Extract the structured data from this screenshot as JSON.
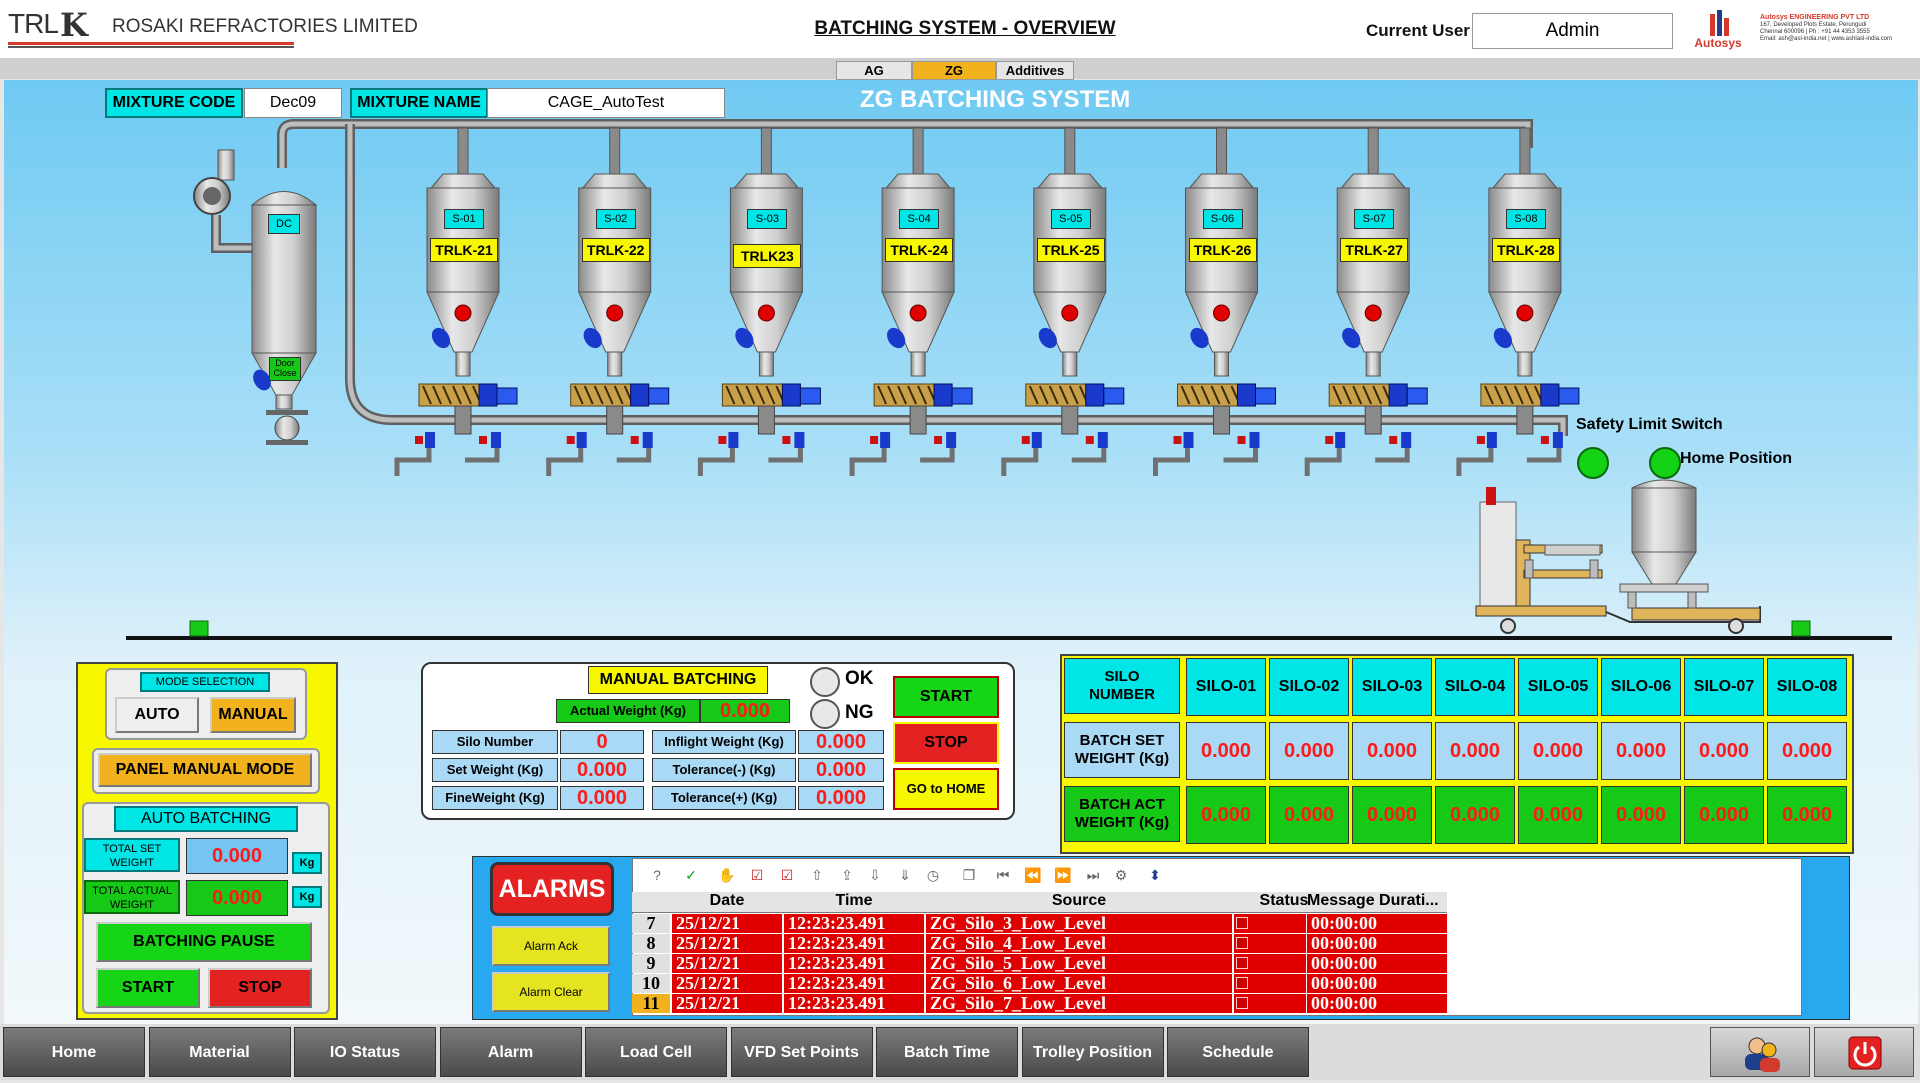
{
  "header": {
    "company_logo_text": "TRL",
    "company_k": "K",
    "company_name": "ROSAKI REFRACTORIES LIMITED",
    "screen_title": "BATCHING SYSTEM - OVERVIEW",
    "current_user_label": "Current User",
    "current_user_value": "Admin",
    "vendor_name": "Autosys",
    "vendor_company": "Autosys ENGINEERING PVT LTD",
    "vendor_address_1": "167, Developed Plots Estate, Perungudi",
    "vendor_address_2": "Chennai 600096 | Ph : +91 44 4353 3555",
    "vendor_address_3": "Email: ash@asl-india.net | www.ashlasl-india.com"
  },
  "tabs": [
    {
      "label": "AG"
    },
    {
      "label": "ZG",
      "active": true
    },
    {
      "label": "Additives"
    }
  ],
  "mixture": {
    "code_label": "MIXTURE CODE",
    "code_value": "Dec09",
    "name_label": "MIXTURE NAME",
    "name_value": "CAGE_AutoTest"
  },
  "system_title": "ZG BATCHING SYSTEM",
  "dust_collector": {
    "label": "DC",
    "door_label_1": "Door",
    "door_label_2": "Close"
  },
  "silos": [
    {
      "id": "S-01",
      "name": "TRLK-21"
    },
    {
      "id": "S-02",
      "name": "TRLK-22"
    },
    {
      "id": "S-03",
      "name": "TRLK23"
    },
    {
      "id": "S-04",
      "name": "TRLK-24"
    },
    {
      "id": "S-05",
      "name": "TRLK-25"
    },
    {
      "id": "S-06",
      "name": "TRLK-26"
    },
    {
      "id": "S-07",
      "name": "TRLK-27"
    },
    {
      "id": "S-08",
      "name": "TRLK-28"
    }
  ],
  "indicators": {
    "safety_limit_switch": "Safety Limit Switch",
    "home_position": "Home Position",
    "on_color": "#14d214",
    "alarm_color": "#e00000"
  },
  "mode_panel": {
    "mode_selection_label": "MODE SELECTION",
    "auto_label": "AUTO",
    "manual_label": "MANUAL",
    "panel_manual_mode_label": "PANEL MANUAL MODE",
    "auto_batching_label": "AUTO BATCHING",
    "total_set_weight_label_1": "TOTAL  SET",
    "total_set_weight_label_2": "WEIGHT",
    "total_set_weight_value": "0.000",
    "total_actual_weight_label_1": "TOTAL  ACTUAL",
    "total_actual_weight_label_2": "WEIGHT",
    "total_actual_weight_value": "0.000",
    "unit": "Kg",
    "batching_pause_label": "BATCHING PAUSE",
    "start_label": "START",
    "stop_label": "STOP"
  },
  "manual_batching": {
    "title": "MANUAL BATCHING",
    "actual_weight_label": "Actual Weight (Kg)",
    "actual_weight_value": "0.000",
    "ok_label": "OK",
    "ng_label": "NG",
    "silo_number_label": "Silo Number",
    "silo_number_value": "0",
    "set_weight_label": "Set Weight (Kg)",
    "set_weight_value": "0.000",
    "fine_weight_label": "FineWeight (Kg)",
    "fine_weight_value": "0.000",
    "inflight_weight_label": "Inflight Weight (Kg)",
    "inflight_weight_value": "0.000",
    "tolerance_minus_label": "Tolerance(-) (Kg)",
    "tolerance_minus_value": "0.000",
    "tolerance_plus_label": "Tolerance(+) (Kg)",
    "tolerance_plus_value": "0.000",
    "start_label": "START",
    "stop_label": "STOP",
    "go_home_label": "GO to HOME"
  },
  "silo_table": {
    "header_label_1": "SILO",
    "header_label_2": "NUMBER",
    "set_label_1": "BATCH SET",
    "set_label_2": "WEIGHT (Kg)",
    "act_label_1": "BATCH ACT",
    "act_label_2": "WEIGHT (Kg)",
    "columns": [
      "SILO-01",
      "SILO-02",
      "SILO-03",
      "SILO-04",
      "SILO-05",
      "SILO-06",
      "SILO-07",
      "SILO-08"
    ],
    "set_values": [
      "0.000",
      "0.000",
      "0.000",
      "0.000",
      "0.000",
      "0.000",
      "0.000",
      "0.000"
    ],
    "act_values": [
      "0.000",
      "0.000",
      "0.000",
      "0.000",
      "0.000",
      "0.000",
      "0.000",
      "0.000"
    ]
  },
  "alarms": {
    "title": "ALARMS",
    "ack_label": "Alarm Ack",
    "clear_label": "Alarm Clear",
    "columns": [
      "Date",
      "Time",
      "Source",
      "Status",
      "Message Durati..."
    ],
    "rows": [
      {
        "num": "7",
        "date": "25/12/21",
        "time": "12:23:23.491",
        "source": "ZG_Silo_3_Low_Level",
        "duration": "00:00:00"
      },
      {
        "num": "8",
        "date": "25/12/21",
        "time": "12:23:23.491",
        "source": "ZG_Silo_4_Low_Level",
        "duration": "00:00:00"
      },
      {
        "num": "9",
        "date": "25/12/21",
        "time": "12:23:23.491",
        "source": "ZG_Silo_5_Low_Level",
        "duration": "00:00:00"
      },
      {
        "num": "10",
        "date": "25/12/21",
        "time": "12:23:23.491",
        "source": "ZG_Silo_6_Low_Level",
        "duration": "00:00:00"
      },
      {
        "num": "11",
        "date": "25/12/21",
        "time": "12:23:23.491",
        "source": "ZG_Silo_7_Low_Level",
        "duration": "00:00:00"
      }
    ]
  },
  "nav": [
    {
      "label": "Home"
    },
    {
      "label": "Material"
    },
    {
      "label": "IO Status"
    },
    {
      "label": "Alarm"
    },
    {
      "label": "Load Cell"
    },
    {
      "label": "VFD Set Points"
    },
    {
      "label": "Batch Time"
    },
    {
      "label": "Trolley Position"
    },
    {
      "label": "Schedule"
    }
  ],
  "nav_icons": [
    {
      "icon": "users-icon"
    },
    {
      "icon": "power-icon"
    }
  ]
}
